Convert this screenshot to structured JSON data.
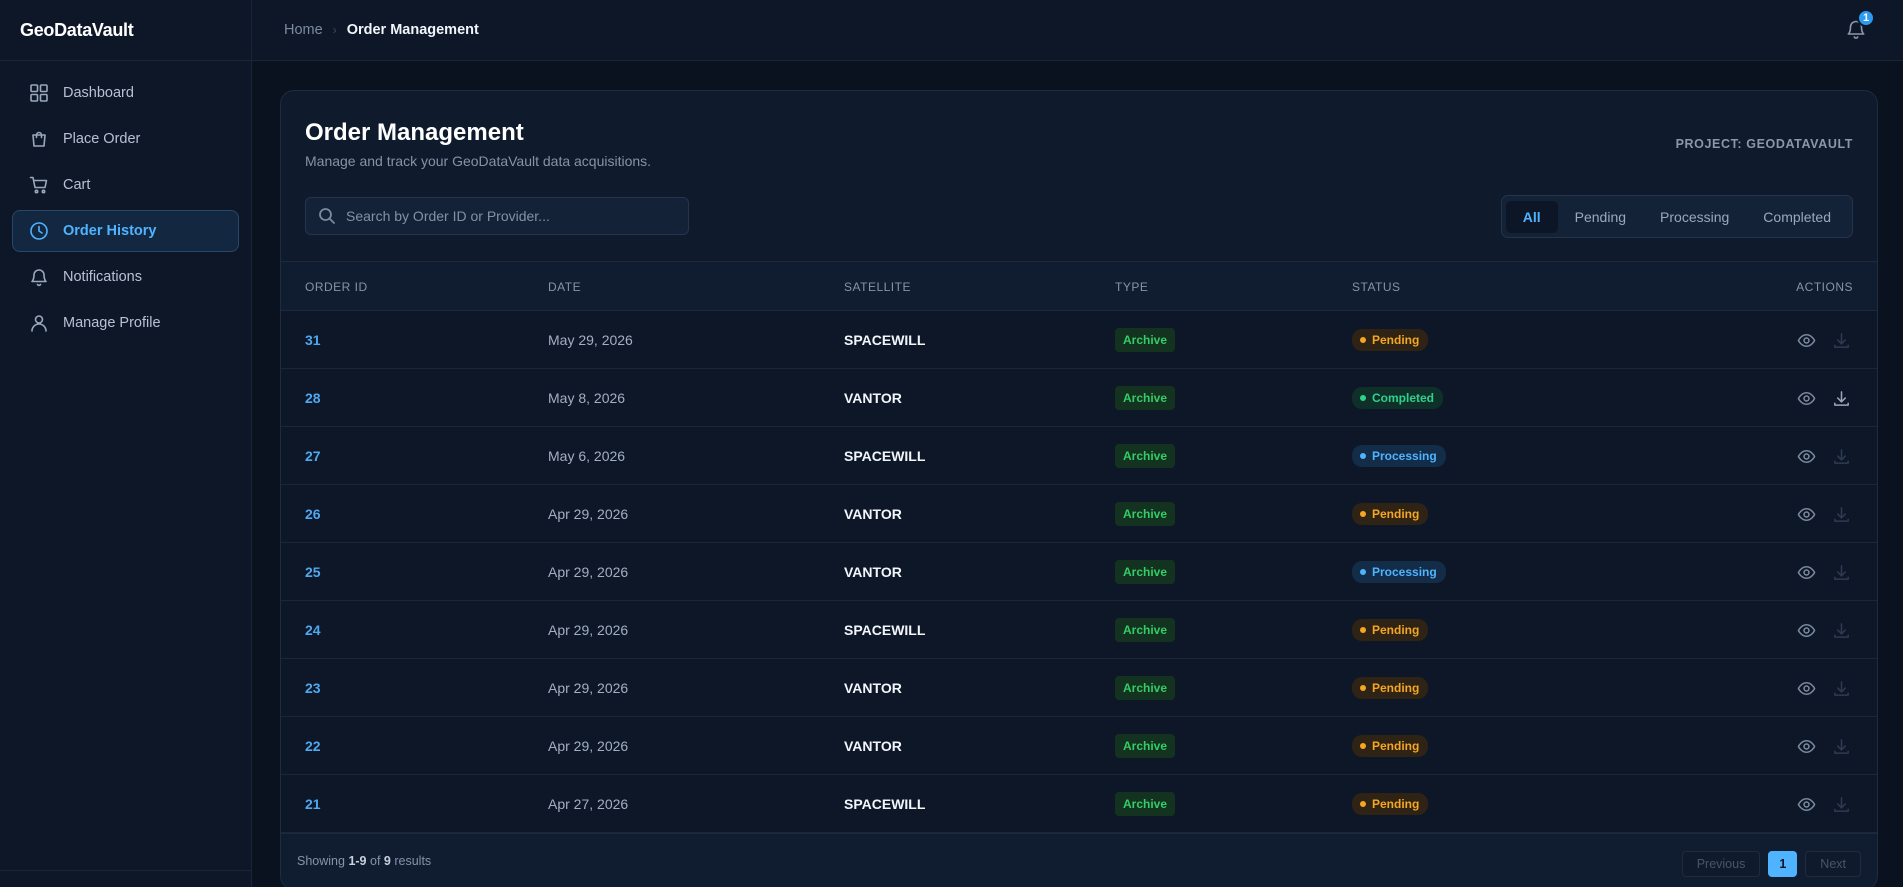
{
  "app": {
    "brand": "GeoDataVault"
  },
  "sidebar": {
    "items": [
      {
        "label": "Dashboard",
        "icon": "grid-icon",
        "active": false
      },
      {
        "label": "Place Order",
        "icon": "shopping-bag-icon",
        "active": false
      },
      {
        "label": "Cart",
        "icon": "cart-icon",
        "active": false
      },
      {
        "label": "Order History",
        "icon": "clock-icon",
        "active": true
      },
      {
        "label": "Notifications",
        "icon": "bell-icon",
        "active": false
      },
      {
        "label": "Manage Profile",
        "icon": "user-icon",
        "active": false
      }
    ]
  },
  "header": {
    "breadcrumb": {
      "home": "Home",
      "separator": "›",
      "current": "Order Management"
    },
    "notifications_count": "1"
  },
  "page": {
    "title": "Order Management",
    "subtitle": "Manage and track your GeoDataVault data acquisitions.",
    "project_label": "PROJECT: GEODATAVAULT",
    "search": {
      "placeholder": "Search by Order ID or Provider...",
      "value": ""
    },
    "filters": [
      {
        "label": "All",
        "active": true
      },
      {
        "label": "Pending",
        "active": false
      },
      {
        "label": "Processing",
        "active": false
      },
      {
        "label": "Completed",
        "active": false
      }
    ]
  },
  "table": {
    "columns": {
      "order_id": "ORDER ID",
      "date": "DATE",
      "satellite": "SATELLITE",
      "type": "TYPE",
      "status": "STATUS",
      "actions": "ACTIONS"
    },
    "rows": [
      {
        "id": "31",
        "date": "May 29, 2026",
        "satellite": "SPACEWILL",
        "type": "Archive",
        "status": "Pending"
      },
      {
        "id": "28",
        "date": "May 8, 2026",
        "satellite": "VANTOR",
        "type": "Archive",
        "status": "Completed"
      },
      {
        "id": "27",
        "date": "May 6, 2026",
        "satellite": "SPACEWILL",
        "type": "Archive",
        "status": "Processing"
      },
      {
        "id": "26",
        "date": "Apr 29, 2026",
        "satellite": "VANTOR",
        "type": "Archive",
        "status": "Pending"
      },
      {
        "id": "25",
        "date": "Apr 29, 2026",
        "satellite": "VANTOR",
        "type": "Archive",
        "status": "Processing"
      },
      {
        "id": "24",
        "date": "Apr 29, 2026",
        "satellite": "SPACEWILL",
        "type": "Archive",
        "status": "Pending"
      },
      {
        "id": "23",
        "date": "Apr 29, 2026",
        "satellite": "VANTOR",
        "type": "Archive",
        "status": "Pending"
      },
      {
        "id": "22",
        "date": "Apr 29, 2026",
        "satellite": "VANTOR",
        "type": "Archive",
        "status": "Pending"
      },
      {
        "id": "21",
        "date": "Apr 27, 2026",
        "satellite": "SPACEWILL",
        "type": "Archive",
        "status": "Pending"
      }
    ]
  },
  "footer": {
    "showing_prefix": "Showing",
    "range": "1-9",
    "of_label": "of",
    "total": "9",
    "results_label": "results",
    "previous": "Previous",
    "current_page": "1",
    "next": "Next"
  },
  "colors": {
    "accent": "#4fb3ff",
    "pending": "#f5a623",
    "completed": "#2fd18e",
    "processing": "#4fb3ff",
    "archive": "#33cc66"
  }
}
